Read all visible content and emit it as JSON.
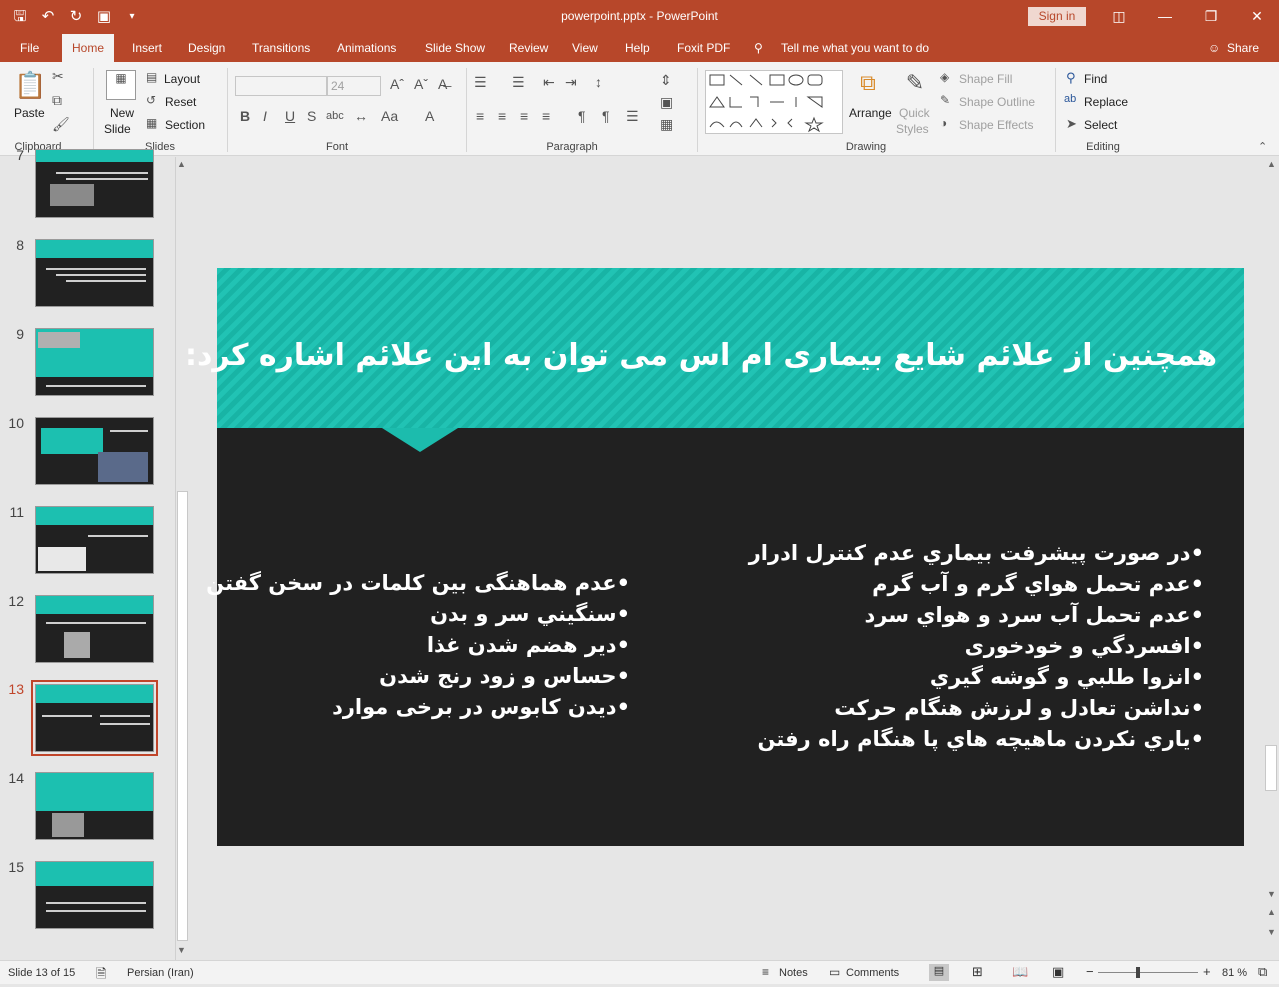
{
  "app": {
    "title": "powerpoint.pptx  -  PowerPoint",
    "sign_in": "Sign in"
  },
  "menu": {
    "tabs": [
      "File",
      "Home",
      "Insert",
      "Design",
      "Transitions",
      "Animations",
      "Slide Show",
      "Review",
      "View",
      "Help",
      "Foxit PDF"
    ],
    "tell_me": "Tell me what you want to do",
    "share": "Share",
    "active": "Home"
  },
  "ribbon": {
    "clipboard": {
      "label": "Clipboard",
      "paste": "Paste"
    },
    "slides": {
      "label": "Slides",
      "new_slide": "New",
      "new_slide2": "Slide",
      "layout": "Layout",
      "reset": "Reset",
      "section": "Section"
    },
    "font": {
      "label": "Font",
      "size": "24"
    },
    "paragraph": {
      "label": "Paragraph"
    },
    "drawing": {
      "label": "Drawing",
      "arrange": "Arrange",
      "quick": "Quick",
      "styles": "Styles",
      "shape_fill": "Shape Fill",
      "shape_outline": "Shape Outline",
      "shape_effects": "Shape Effects"
    },
    "editing": {
      "label": "Editing",
      "find": "Find",
      "replace": "Replace",
      "select": "Select"
    }
  },
  "thumbnails": [
    "7",
    "8",
    "9",
    "10",
    "11",
    "12",
    "13",
    "14",
    "15"
  ],
  "selected_slide": "13",
  "slide": {
    "title": "همچنین از علائم شایع بیماری ام اس می توان به این علائم اشاره کرد:",
    "right_bullets": [
      "•در صورت پیشرفت بیماري عدم کنترل ادرار",
      "•عدم تحمل هواي گرم و آب گرم",
      "•عدم تحمل آب سرد و هواي سرد",
      "•افسردگي و خودخوری",
      "•انزوا طلبي و گوشه گيري",
      "•نداشن تعادل و لرزش هنگام حرکت",
      "•ياري نکردن ماهيچه هاي پا هنگام راه رفتن"
    ],
    "left_bullets": [
      "•عدم هماهنگی بين کلمات در سخن گفتن",
      "•سنگيني سر و بدن",
      "•دير هضم شدن غذا",
      "•حساس و زود رنج شدن",
      "•ديدن کابوس در برخی موارد"
    ]
  },
  "status": {
    "slide_of": "Slide 13 of 15",
    "language": "Persian (Iran)",
    "notes": "Notes",
    "comments": "Comments",
    "zoom": "81 %"
  }
}
